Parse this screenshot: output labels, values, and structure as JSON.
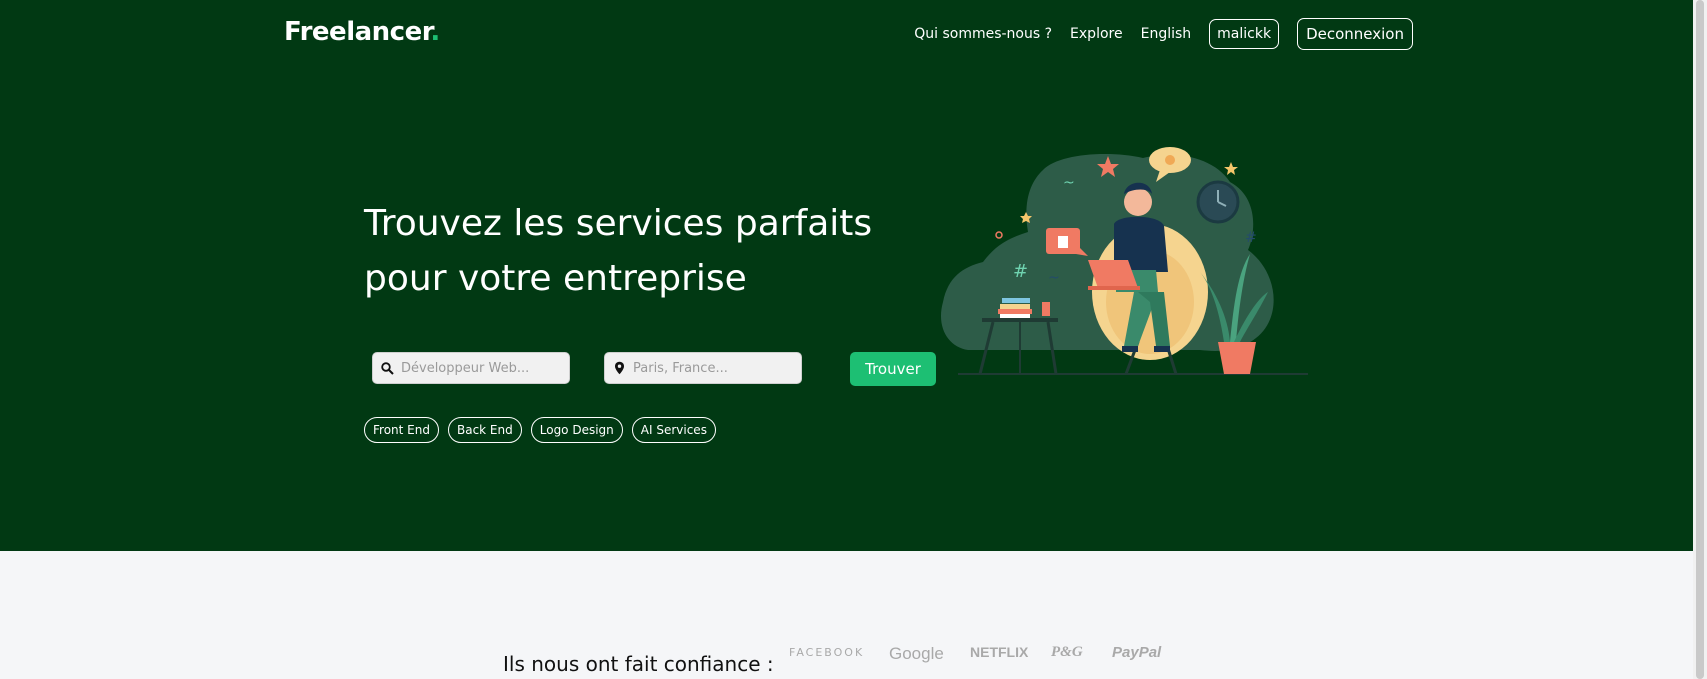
{
  "header": {
    "logo_text": "Freelancer",
    "logo_dot": ".",
    "nav": {
      "about": "Qui sommes-nous ?",
      "explore": "Explore",
      "language": "English",
      "username": "malickk",
      "logout": "Deconnexion"
    }
  },
  "hero": {
    "headline_line1": "Trouvez les services parfaits",
    "headline_line2": "pour votre entreprise",
    "search_service_placeholder": "Développeur Web...",
    "search_location_placeholder": "Paris, France...",
    "find_button": "Trouver",
    "tags": [
      "Front End",
      "Back End",
      "Logo Design",
      "AI Services"
    ]
  },
  "trust": {
    "label": "Ils nous ont fait confiance :",
    "brands": [
      "FACEBOOK",
      "Google",
      "NETFLIX",
      "P&G",
      "PayPal"
    ]
  },
  "colors": {
    "hero_bg": "#013913",
    "accent": "#1dbf73"
  },
  "icons": {
    "search": "search-icon",
    "location": "location-pin-icon"
  }
}
